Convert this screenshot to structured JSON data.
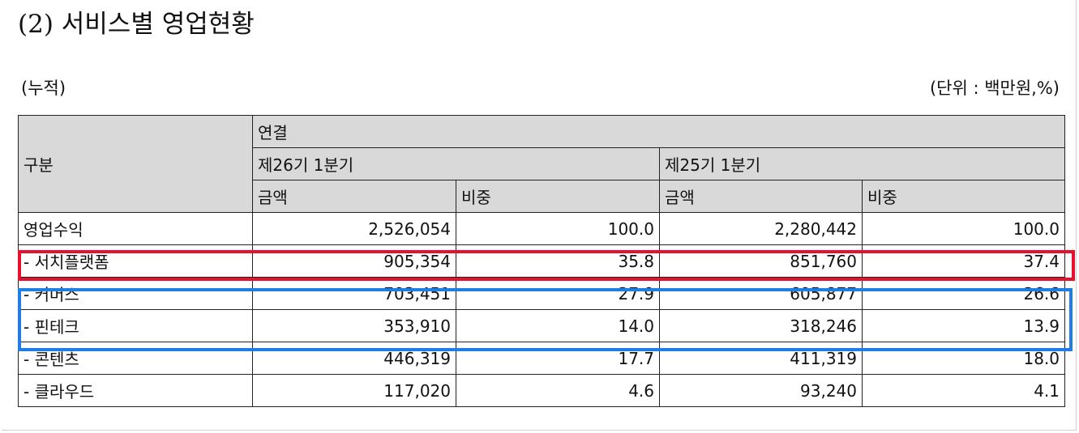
{
  "title": "(2) 서비스별 영업현황",
  "basis": "(누적)",
  "unit": "(단위 : 백만원,%)",
  "header": {
    "category": "구분",
    "group": "연결",
    "period1": "제26기 1분기",
    "period2": "제25기 1분기",
    "amount": "금액",
    "ratio": "비중"
  },
  "rows": [
    {
      "label": "영업수익",
      "p1_amount": "2,526,054",
      "p1_ratio": "100.0",
      "p2_amount": "2,280,442",
      "p2_ratio": "100.0"
    },
    {
      "label": "- 서치플랫폼",
      "p1_amount": "905,354",
      "p1_ratio": "35.8",
      "p2_amount": "851,760",
      "p2_ratio": "37.4"
    },
    {
      "label": "- 커머스",
      "p1_amount": "703,451",
      "p1_ratio": "27.9",
      "p2_amount": "605,877",
      "p2_ratio": "26.6"
    },
    {
      "label": "- 핀테크",
      "p1_amount": "353,910",
      "p1_ratio": "14.0",
      "p2_amount": "318,246",
      "p2_ratio": "13.9"
    },
    {
      "label": "- 콘텐츠",
      "p1_amount": "446,319",
      "p1_ratio": "17.7",
      "p2_amount": "411,319",
      "p2_ratio": "18.0"
    },
    {
      "label": "- 클라우드",
      "p1_amount": "117,020",
      "p1_ratio": "4.6",
      "p2_amount": "93,240",
      "p2_ratio": "4.1"
    }
  ],
  "highlights": {
    "red": "#e8112d",
    "blue": "#1f7de5"
  }
}
